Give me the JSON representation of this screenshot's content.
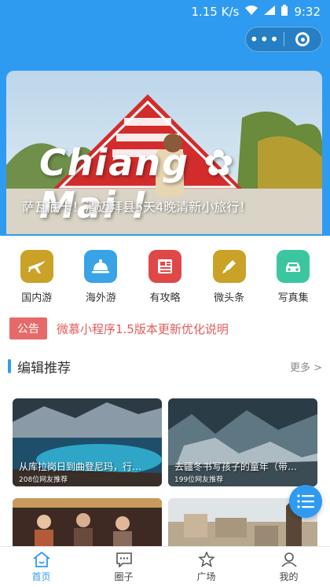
{
  "status_bar": {
    "speed": "1.15 K/s",
    "time": "9:32"
  },
  "capsule": {
    "more": "•••"
  },
  "banner": {
    "city": "Chiang ✿ Mai !",
    "caption": "萨瓦底卡！清迈拜县5天4晚清新小旅行！"
  },
  "nav": [
    {
      "label": "国内游",
      "icon": "airplane-icon",
      "color": "#c9a227"
    },
    {
      "label": "海外游",
      "icon": "cloche-icon",
      "color": "#3aa3e8"
    },
    {
      "label": "有攻略",
      "icon": "newspaper-icon",
      "color": "#e04848"
    },
    {
      "label": "微头条",
      "icon": "pen-icon",
      "color": "#c9a227"
    },
    {
      "label": "写真集",
      "icon": "car-icon",
      "color": "#3cc6a0"
    }
  ],
  "notice": {
    "tag": "公告",
    "text": "微慕小程序1.5版本更新优化说明"
  },
  "section": {
    "title": "编辑推荐",
    "more": "更多 >"
  },
  "cards": [
    {
      "title": "从库拉岗日到曲登尼玛，行…",
      "meta": "208位网友推荐"
    },
    {
      "title": "去疆冬书写孩子的童年（带…",
      "meta": "199位网友推荐"
    },
    {
      "title": "",
      "meta": ""
    },
    {
      "title": "",
      "meta": ""
    }
  ],
  "tabs": [
    {
      "label": "首页",
      "icon": "home-icon",
      "active": true
    },
    {
      "label": "圈子",
      "icon": "chat-icon",
      "active": false
    },
    {
      "label": "广场",
      "icon": "star-icon",
      "active": false
    },
    {
      "label": "我的",
      "icon": "user-icon",
      "active": false
    }
  ],
  "colors": {
    "primary": "#2f9bf0",
    "notice": "#e76a6a"
  }
}
